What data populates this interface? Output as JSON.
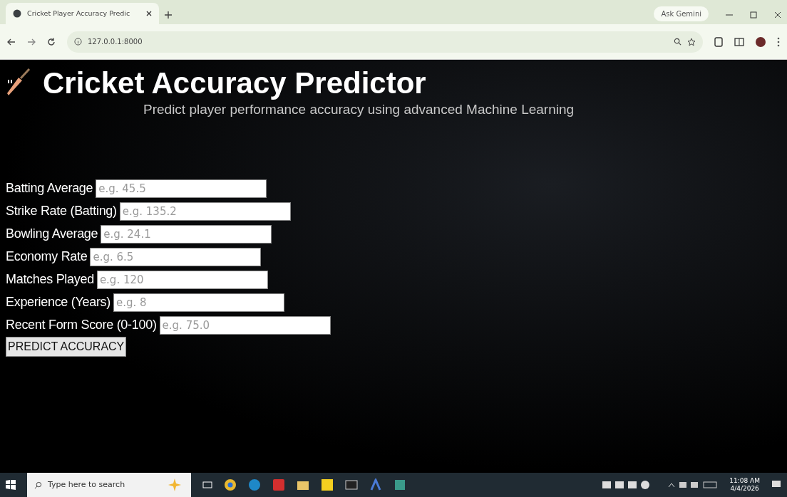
{
  "browser": {
    "tab_title": "Cricket Player Accuracy Predic",
    "url": "127.0.0.1:8000",
    "ask_button": "Ask Gemini"
  },
  "page": {
    "title": "Cricket Accuracy Predictor",
    "subtitle": "Predict player performance accuracy using advanced Machine Learning",
    "fields": [
      {
        "label": "Batting Average",
        "placeholder": "e.g. 45.5"
      },
      {
        "label": "Strike Rate (Batting)",
        "placeholder": "e.g. 135.2"
      },
      {
        "label": "Bowling Average",
        "placeholder": "e.g. 24.1"
      },
      {
        "label": "Economy Rate",
        "placeholder": "e.g. 6.5"
      },
      {
        "label": "Matches Played",
        "placeholder": "e.g. 120"
      },
      {
        "label": "Experience (Years)",
        "placeholder": "e.g. 8"
      },
      {
        "label": "Recent Form Score (0-100)",
        "placeholder": "e.g. 75.0"
      }
    ],
    "button": "PREDICT ACCURACY"
  },
  "taskbar": {
    "search_placeholder": "Type here to search",
    "time": "11:08 AM",
    "date": "4/4/2026"
  }
}
